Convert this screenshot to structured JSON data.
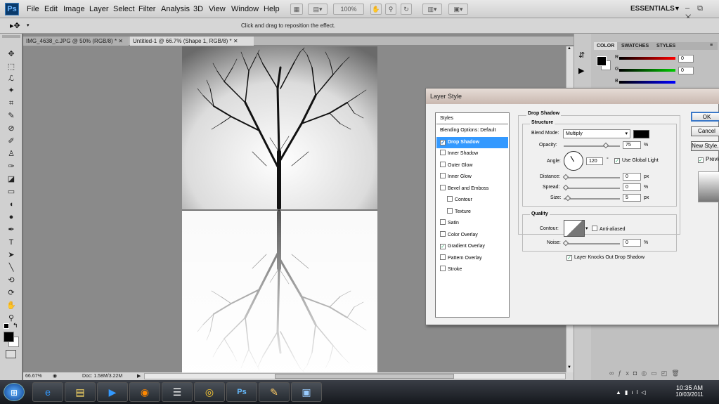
{
  "menubar": {
    "items": [
      "File",
      "Edit",
      "Image",
      "Layer",
      "Select",
      "Filter",
      "Analysis",
      "3D",
      "View",
      "Window",
      "Help"
    ],
    "zoom": "100%",
    "workspace": "ESSENTIALS",
    "window_controls": "– ⧉ ✕"
  },
  "options": {
    "message": "Click and drag to reposition the effect."
  },
  "tabs": [
    "IMG_4638_c.JPG @ 50% (RGB/8) *",
    "Untitled-1 @ 66.7% (Shape 1, RGB/8) *"
  ],
  "status": {
    "zoom": "66.67%",
    "doc": "Doc: 1.58M/3.22M"
  },
  "panel": {
    "tabs": [
      "COLOR",
      "SWATCHES",
      "STYLES"
    ],
    "r_label": "R",
    "g_label": "G",
    "b_label": "B",
    "r": "0",
    "g": "0",
    "b": "0"
  },
  "dialog": {
    "title": "Layer Style",
    "styles_header": "Styles",
    "blending": "Blending Options: Default",
    "styles": [
      {
        "label": "Drop Shadow",
        "checked": true
      },
      {
        "label": "Inner Shadow",
        "checked": false
      },
      {
        "label": "Outer Glow",
        "checked": false
      },
      {
        "label": "Inner Glow",
        "checked": false
      },
      {
        "label": "Bevel and Emboss",
        "checked": false
      },
      {
        "label": "Contour",
        "checked": false
      },
      {
        "label": "Texture",
        "checked": false
      },
      {
        "label": "Satin",
        "checked": false
      },
      {
        "label": "Color Overlay",
        "checked": false
      },
      {
        "label": "Gradient Overlay",
        "checked": true
      },
      {
        "label": "Pattern Overlay",
        "checked": false
      },
      {
        "label": "Stroke",
        "checked": false
      }
    ],
    "section": "Drop Shadow",
    "structure": "Structure",
    "blend_mode_label": "Blend Mode:",
    "blend_mode": "Multiply",
    "opacity_label": "Opacity:",
    "opacity": "75",
    "pct": "%",
    "angle_label": "Angle:",
    "angle": "120",
    "deg": "°",
    "global_light": "Use Global Light",
    "distance_label": "Distance:",
    "distance": "0",
    "px": "px",
    "spread_label": "Spread:",
    "spread": "0",
    "size_label": "Size:",
    "size": "5",
    "quality": "Quality",
    "contour_label": "Contour:",
    "anti_aliased": "Anti-aliased",
    "noise_label": "Noise:",
    "noise": "0",
    "knockout": "Layer Knocks Out Drop Shadow",
    "ok": "OK",
    "cancel": "Cancel",
    "new_style": "New Style...",
    "preview": "Preview"
  },
  "taskbar": {
    "time": "10:35 AM",
    "date": "10/03/2011"
  }
}
